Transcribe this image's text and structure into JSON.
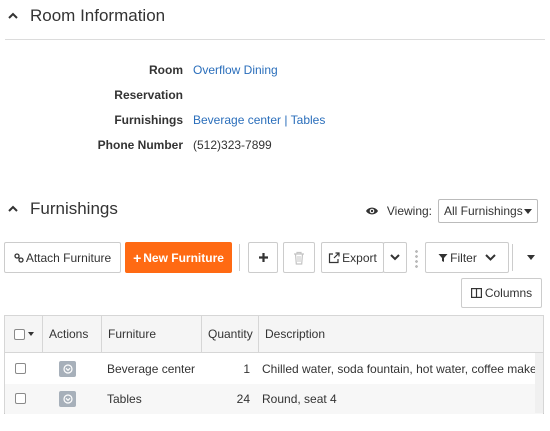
{
  "room_info": {
    "title": "Room Information",
    "fields": [
      {
        "label": "Room",
        "value": "Overflow Dining"
      },
      {
        "label": "Reservation",
        "value": ""
      },
      {
        "label": "Furnishings",
        "value_links": [
          "Beverage center",
          "Tables"
        ],
        "separator": " | "
      },
      {
        "label": "Phone Number",
        "value": "(512)323-7899"
      }
    ]
  },
  "furnishings": {
    "title": "Furnishings",
    "viewing_label": "Viewing:",
    "viewing_value": "All Furnishings"
  },
  "toolbar": {
    "attach_label": "Attach Furniture",
    "new_label": "New Furniture",
    "export_label": "Export",
    "filter_label": "Filter",
    "columns_label": "Columns"
  },
  "grid": {
    "columns": [
      "Actions",
      "Furniture",
      "Quantity",
      "Description"
    ],
    "rows": [
      {
        "furniture": "Beverage center",
        "quantity": "1",
        "description": "Chilled water, soda fountain, hot water, coffee maker"
      },
      {
        "furniture": "Tables",
        "quantity": "24",
        "description": "Round, seat 4"
      }
    ]
  },
  "colors": {
    "accent_orange": "#ff6a13",
    "link_blue": "#2a6ebb",
    "action_icon_gray": "#a7b0ba"
  },
  "icons": [
    "chevron-up-icon",
    "eye-icon",
    "paperclip-icon",
    "plus-icon",
    "trash-icon",
    "export-icon",
    "chevron-down-icon",
    "filter-icon",
    "columns-icon",
    "checkbox-icon",
    "action-menu-icon"
  ]
}
